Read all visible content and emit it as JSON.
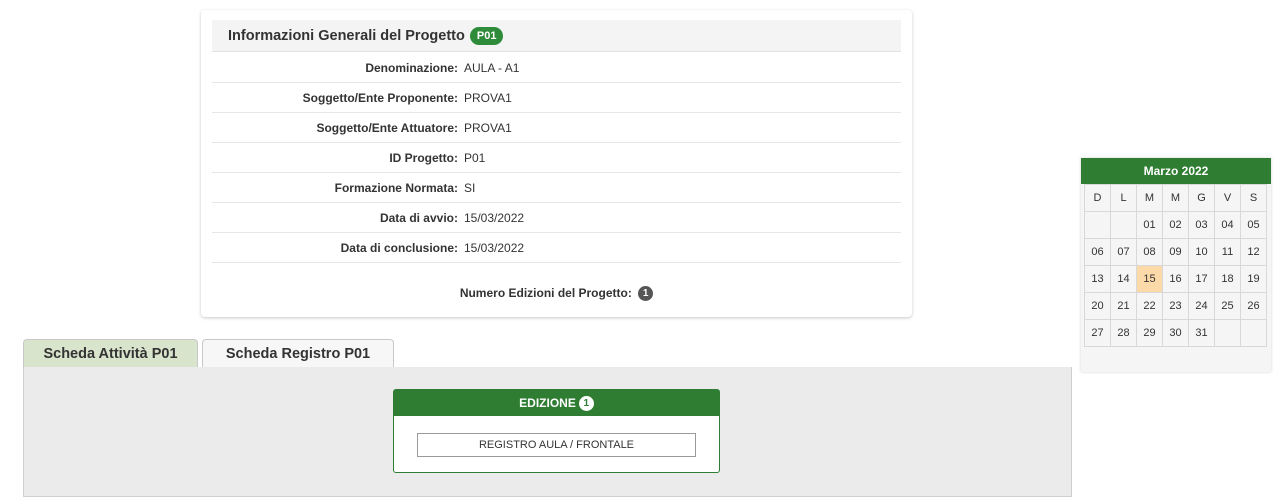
{
  "project_info": {
    "title": "Informazioni Generali del Progetto",
    "badge": "P01",
    "rows": [
      {
        "label": "Denominazione:",
        "value": "AULA - A1"
      },
      {
        "label": "Soggetto/Ente Proponente:",
        "value": "PROVA1"
      },
      {
        "label": "Soggetto/Ente Attuatore:",
        "value": "PROVA1"
      },
      {
        "label": "ID Progetto:",
        "value": "P01"
      },
      {
        "label": "Formazione Normata:",
        "value": "SI"
      },
      {
        "label": "Data di avvio:",
        "value": "15/03/2022"
      },
      {
        "label": "Data di conclusione:",
        "value": "15/03/2022"
      }
    ],
    "editions_label": "Numero Edizioni del Progetto:",
    "editions_count": "1"
  },
  "tabs": [
    {
      "label": "Scheda Attività P01"
    },
    {
      "label": "Scheda Registro P01"
    }
  ],
  "edition_box": {
    "title": "EDIZIONE",
    "badge": "1",
    "button_label": "REGISTRO AULA / FRONTALE"
  },
  "calendar": {
    "title": "Marzo 2022",
    "weekdays": [
      "D",
      "L",
      "M",
      "M",
      "G",
      "V",
      "S"
    ],
    "weeks": [
      [
        "",
        "",
        "01",
        "02",
        "03",
        "04",
        "05"
      ],
      [
        "06",
        "07",
        "08",
        "09",
        "10",
        "11",
        "12"
      ],
      [
        "13",
        "14",
        "15",
        "16",
        "17",
        "18",
        "19"
      ],
      [
        "20",
        "21",
        "22",
        "23",
        "24",
        "25",
        "26"
      ],
      [
        "27",
        "28",
        "29",
        "30",
        "31",
        "",
        ""
      ]
    ],
    "highlighted_day": "15",
    "colors": {
      "header": "#2e7d32",
      "highlight": "#fcd9a8"
    }
  }
}
